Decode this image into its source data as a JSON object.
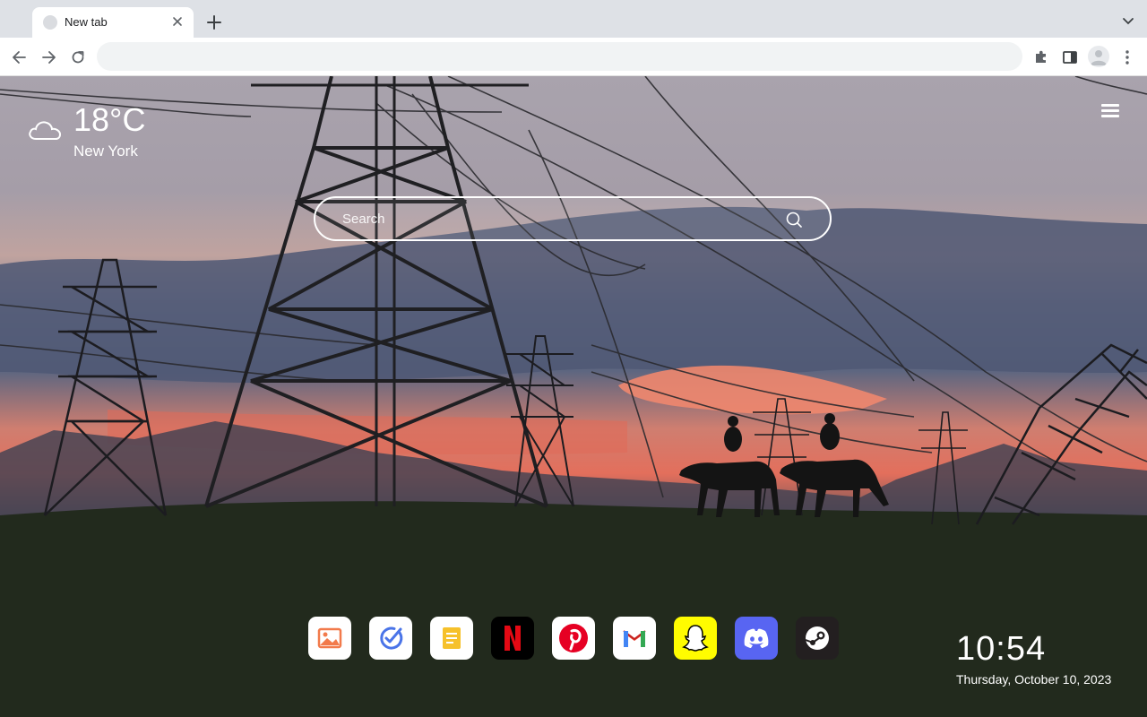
{
  "browser": {
    "tab": {
      "title": "New tab"
    },
    "omnibox": {
      "value": "",
      "placeholder": ""
    },
    "toolbar_icons": [
      "back-icon",
      "forward-icon",
      "reload-icon",
      "extensions-icon",
      "side-panel-icon",
      "profile-avatar",
      "kebab-menu-icon"
    ]
  },
  "weather": {
    "temperature": "18°C",
    "city": "New York",
    "icon": "cloud-icon"
  },
  "search": {
    "placeholder": "Search"
  },
  "apps": [
    {
      "name": "gallery",
      "icon": "image-icon",
      "bg": "#ffffff"
    },
    {
      "name": "task",
      "icon": "check-icon",
      "bg": "#ffffff"
    },
    {
      "name": "notes",
      "icon": "notes-icon",
      "bg": "#ffffff"
    },
    {
      "name": "netflix",
      "icon": "netflix-icon",
      "bg": "#000000"
    },
    {
      "name": "pinterest",
      "icon": "pinterest-icon",
      "bg": "#ffffff"
    },
    {
      "name": "gmail",
      "icon": "gmail-icon",
      "bg": "#ffffff"
    },
    {
      "name": "snapchat",
      "icon": "snapchat-icon",
      "bg": "#fffc00"
    },
    {
      "name": "discord",
      "icon": "discord-icon",
      "bg": "#5865f2"
    },
    {
      "name": "steam",
      "icon": "steam-icon",
      "bg": "#231f20"
    }
  ],
  "clock": {
    "time": "10:54",
    "date": "Thursday, October 10, 2023"
  }
}
